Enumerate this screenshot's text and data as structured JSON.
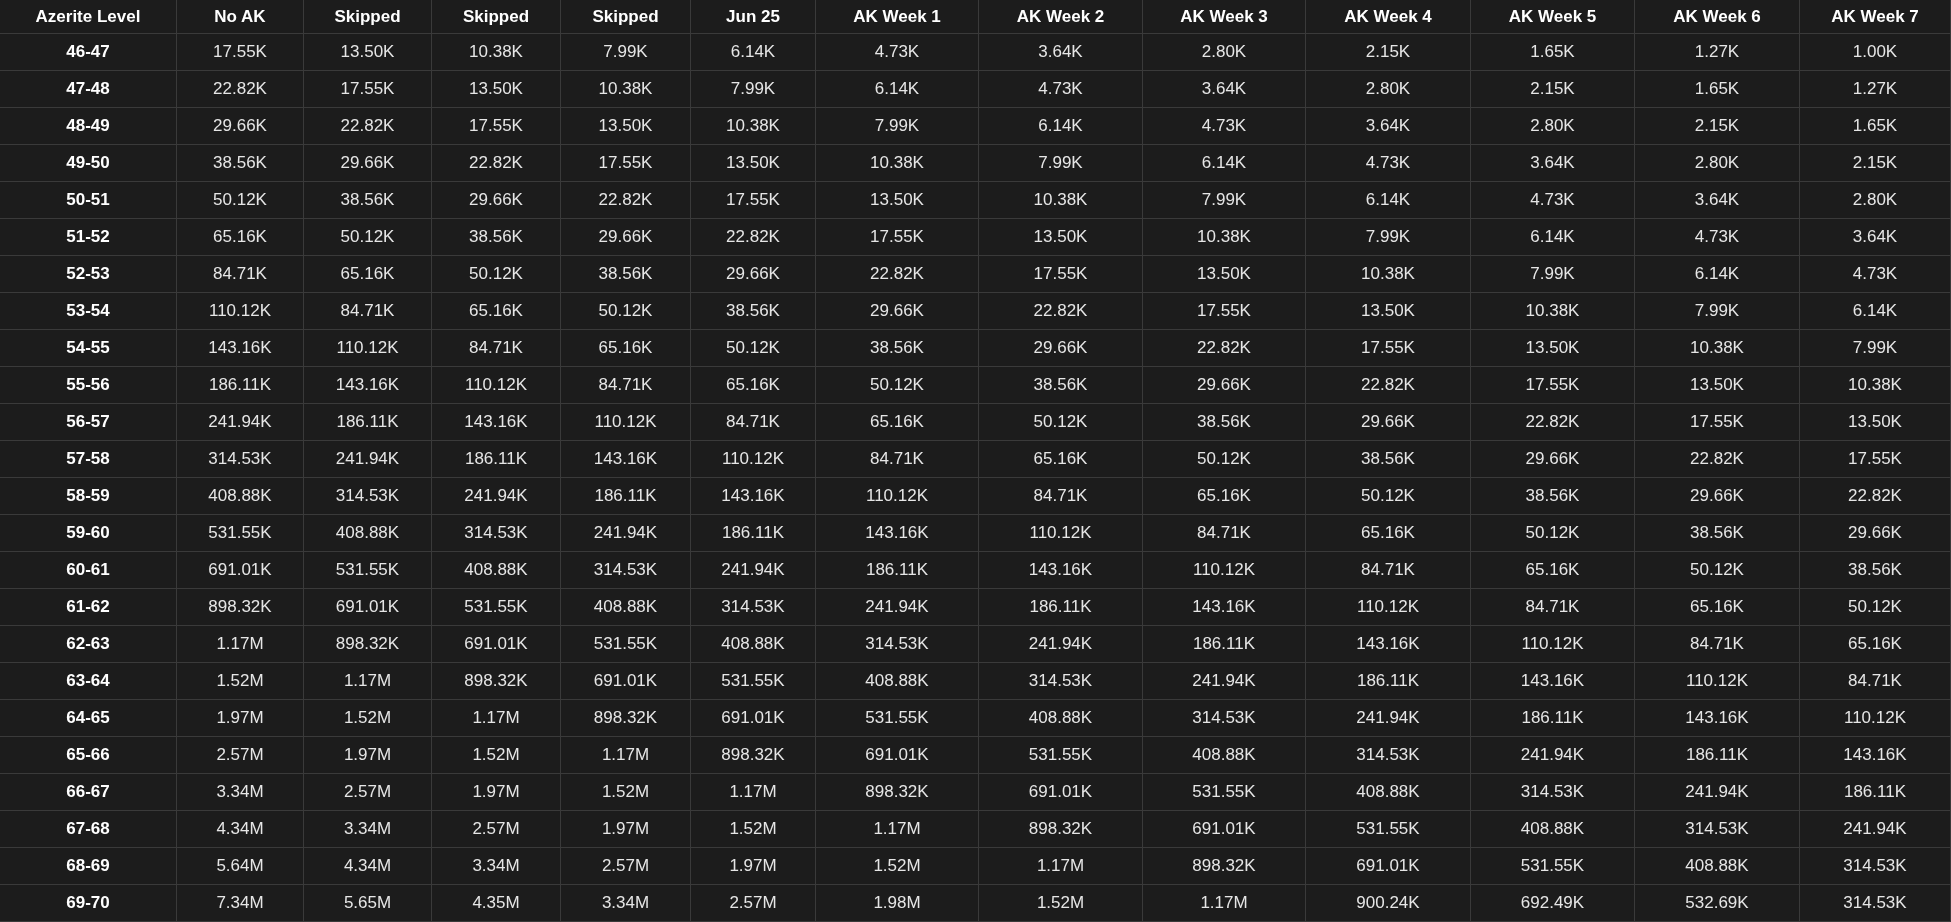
{
  "table": {
    "columns": [
      "Azerite Level",
      "No AK",
      "Skipped",
      "Skipped",
      "Skipped",
      "Jun 25",
      "AK Week 1",
      "AK Week 2",
      "AK Week 3",
      "AK Week 4",
      "AK Week 5",
      "AK Week 6",
      "AK Week 7"
    ],
    "rows": [
      [
        "46-47",
        "17.55K",
        "13.50K",
        "10.38K",
        "7.99K",
        "6.14K",
        "4.73K",
        "3.64K",
        "2.80K",
        "2.15K",
        "1.65K",
        "1.27K",
        "1.00K"
      ],
      [
        "47-48",
        "22.82K",
        "17.55K",
        "13.50K",
        "10.38K",
        "7.99K",
        "6.14K",
        "4.73K",
        "3.64K",
        "2.80K",
        "2.15K",
        "1.65K",
        "1.27K"
      ],
      [
        "48-49",
        "29.66K",
        "22.82K",
        "17.55K",
        "13.50K",
        "10.38K",
        "7.99K",
        "6.14K",
        "4.73K",
        "3.64K",
        "2.80K",
        "2.15K",
        "1.65K"
      ],
      [
        "49-50",
        "38.56K",
        "29.66K",
        "22.82K",
        "17.55K",
        "13.50K",
        "10.38K",
        "7.99K",
        "6.14K",
        "4.73K",
        "3.64K",
        "2.80K",
        "2.15K"
      ],
      [
        "50-51",
        "50.12K",
        "38.56K",
        "29.66K",
        "22.82K",
        "17.55K",
        "13.50K",
        "10.38K",
        "7.99K",
        "6.14K",
        "4.73K",
        "3.64K",
        "2.80K"
      ],
      [
        "51-52",
        "65.16K",
        "50.12K",
        "38.56K",
        "29.66K",
        "22.82K",
        "17.55K",
        "13.50K",
        "10.38K",
        "7.99K",
        "6.14K",
        "4.73K",
        "3.64K"
      ],
      [
        "52-53",
        "84.71K",
        "65.16K",
        "50.12K",
        "38.56K",
        "29.66K",
        "22.82K",
        "17.55K",
        "13.50K",
        "10.38K",
        "7.99K",
        "6.14K",
        "4.73K"
      ],
      [
        "53-54",
        "110.12K",
        "84.71K",
        "65.16K",
        "50.12K",
        "38.56K",
        "29.66K",
        "22.82K",
        "17.55K",
        "13.50K",
        "10.38K",
        "7.99K",
        "6.14K"
      ],
      [
        "54-55",
        "143.16K",
        "110.12K",
        "84.71K",
        "65.16K",
        "50.12K",
        "38.56K",
        "29.66K",
        "22.82K",
        "17.55K",
        "13.50K",
        "10.38K",
        "7.99K"
      ],
      [
        "55-56",
        "186.11K",
        "143.16K",
        "110.12K",
        "84.71K",
        "65.16K",
        "50.12K",
        "38.56K",
        "29.66K",
        "22.82K",
        "17.55K",
        "13.50K",
        "10.38K"
      ],
      [
        "56-57",
        "241.94K",
        "186.11K",
        "143.16K",
        "110.12K",
        "84.71K",
        "65.16K",
        "50.12K",
        "38.56K",
        "29.66K",
        "22.82K",
        "17.55K",
        "13.50K"
      ],
      [
        "57-58",
        "314.53K",
        "241.94K",
        "186.11K",
        "143.16K",
        "110.12K",
        "84.71K",
        "65.16K",
        "50.12K",
        "38.56K",
        "29.66K",
        "22.82K",
        "17.55K"
      ],
      [
        "58-59",
        "408.88K",
        "314.53K",
        "241.94K",
        "186.11K",
        "143.16K",
        "110.12K",
        "84.71K",
        "65.16K",
        "50.12K",
        "38.56K",
        "29.66K",
        "22.82K"
      ],
      [
        "59-60",
        "531.55K",
        "408.88K",
        "314.53K",
        "241.94K",
        "186.11K",
        "143.16K",
        "110.12K",
        "84.71K",
        "65.16K",
        "50.12K",
        "38.56K",
        "29.66K"
      ],
      [
        "60-61",
        "691.01K",
        "531.55K",
        "408.88K",
        "314.53K",
        "241.94K",
        "186.11K",
        "143.16K",
        "110.12K",
        "84.71K",
        "65.16K",
        "50.12K",
        "38.56K"
      ],
      [
        "61-62",
        "898.32K",
        "691.01K",
        "531.55K",
        "408.88K",
        "314.53K",
        "241.94K",
        "186.11K",
        "143.16K",
        "110.12K",
        "84.71K",
        "65.16K",
        "50.12K"
      ],
      [
        "62-63",
        "1.17M",
        "898.32K",
        "691.01K",
        "531.55K",
        "408.88K",
        "314.53K",
        "241.94K",
        "186.11K",
        "143.16K",
        "110.12K",
        "84.71K",
        "65.16K"
      ],
      [
        "63-64",
        "1.52M",
        "1.17M",
        "898.32K",
        "691.01K",
        "531.55K",
        "408.88K",
        "314.53K",
        "241.94K",
        "186.11K",
        "143.16K",
        "110.12K",
        "84.71K"
      ],
      [
        "64-65",
        "1.97M",
        "1.52M",
        "1.17M",
        "898.32K",
        "691.01K",
        "531.55K",
        "408.88K",
        "314.53K",
        "241.94K",
        "186.11K",
        "143.16K",
        "110.12K"
      ],
      [
        "65-66",
        "2.57M",
        "1.97M",
        "1.52M",
        "1.17M",
        "898.32K",
        "691.01K",
        "531.55K",
        "408.88K",
        "314.53K",
        "241.94K",
        "186.11K",
        "143.16K"
      ],
      [
        "66-67",
        "3.34M",
        "2.57M",
        "1.97M",
        "1.52M",
        "1.17M",
        "898.32K",
        "691.01K",
        "531.55K",
        "408.88K",
        "314.53K",
        "241.94K",
        "186.11K"
      ],
      [
        "67-68",
        "4.34M",
        "3.34M",
        "2.57M",
        "1.97M",
        "1.52M",
        "1.17M",
        "898.32K",
        "691.01K",
        "531.55K",
        "408.88K",
        "314.53K",
        "241.94K"
      ],
      [
        "68-69",
        "5.64M",
        "4.34M",
        "3.34M",
        "2.57M",
        "1.97M",
        "1.52M",
        "1.17M",
        "898.32K",
        "691.01K",
        "531.55K",
        "408.88K",
        "314.53K"
      ],
      [
        "69-70",
        "7.34M",
        "5.65M",
        "4.35M",
        "3.34M",
        "2.57M",
        "1.98M",
        "1.52M",
        "1.17M",
        "900.24K",
        "692.49K",
        "532.69K",
        "314.53K"
      ]
    ]
  }
}
